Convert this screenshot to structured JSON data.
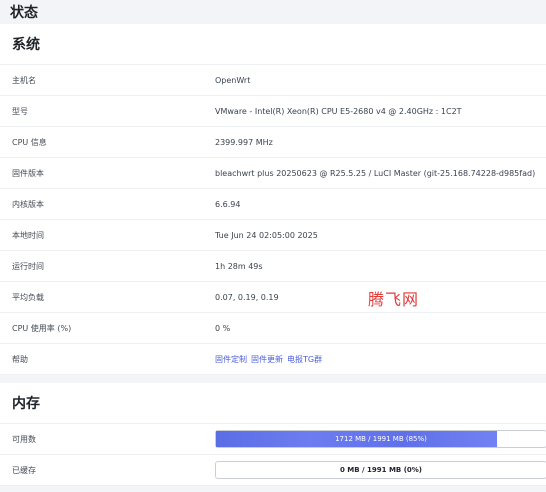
{
  "page": {
    "title": "状态"
  },
  "system": {
    "title": "系统",
    "rows": [
      {
        "label": "主机名",
        "value": "OpenWrt"
      },
      {
        "label": "型号",
        "value": "VMware - Intel(R) Xeon(R) CPU E5-2680 v4 @ 2.40GHz : 1C2T"
      },
      {
        "label": "CPU 信息",
        "value": "2399.997 MHz"
      },
      {
        "label": "固件版本",
        "value": "bleachwrt plus 20250623 @ R25.5.25 / LuCI Master (git-25.168.74228-d985fad)"
      },
      {
        "label": "内核版本",
        "value": "6.6.94"
      },
      {
        "label": "本地时间",
        "value": "Tue Jun 24 02:05:00 2025"
      },
      {
        "label": "运行时间",
        "value": "1h 28m 49s"
      },
      {
        "label": "平均负载",
        "value": "0.07, 0.19, 0.19"
      },
      {
        "label": "CPU 使用率 (%)",
        "value": "0 %"
      }
    ],
    "help": {
      "label": "帮助",
      "links": [
        "固件定制",
        "固件更新",
        "电报TG群"
      ]
    }
  },
  "memory": {
    "title": "内存",
    "available": {
      "label": "可用数",
      "text": "1712 MB / 1991 MB (85%)",
      "percent": 85
    },
    "cached": {
      "label": "已缓存",
      "text": "0 MB / 1991 MB (0%)",
      "percent": 0
    }
  },
  "watermark": "腾飞网",
  "colors": {
    "accent": "#5a6de5",
    "link": "#4c5fd6",
    "watermark": "#e03a3a"
  }
}
